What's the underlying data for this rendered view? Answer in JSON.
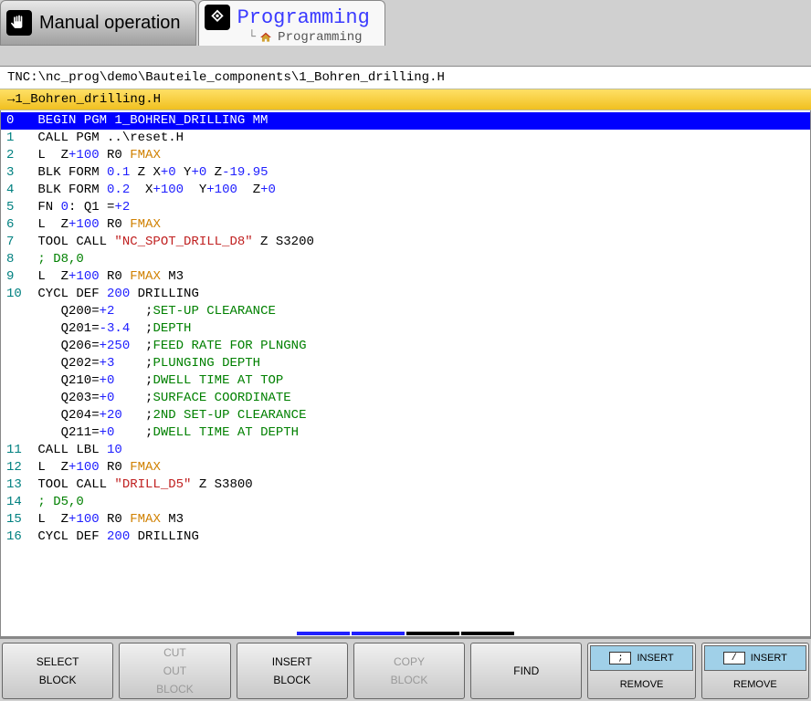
{
  "tabs": {
    "manual": "Manual operation",
    "programming": "Programming",
    "sub": "Programming"
  },
  "path": "TNC:\\nc_prog\\demo\\Bauteile_components\\1_Bohren_drilling.H",
  "file": "1_Bohren_drilling.H",
  "code": {
    "l0": {
      "n": "0",
      "a": " BEGIN PGM 1_BOHREN_DRILLING MM"
    },
    "l1": {
      "n": "1",
      "a": " CALL PGM ..\\reset.H"
    },
    "l2": {
      "n": "2",
      "a": " L  Z",
      "b": "+100",
      "c": " R0 ",
      "d": "FMAX"
    },
    "l3": {
      "n": "3",
      "a": " BLK FORM ",
      "b": "0.1",
      "c": " Z X",
      "d": "+0",
      "e": " Y",
      "f": "+0",
      "g": " Z",
      "h": "-19.95"
    },
    "l4": {
      "n": "4",
      "a": " BLK FORM ",
      "b": "0.2",
      "c": "  X",
      "d": "+100",
      "e": "  Y",
      "f": "+100",
      "g": "  Z",
      "h": "+0"
    },
    "l5": {
      "n": "5",
      "a": " FN ",
      "b": "0",
      "c": ": Q1 =",
      "d": "+2"
    },
    "l6": {
      "n": "6",
      "a": " L  Z",
      "b": "+100",
      "c": " R0 ",
      "d": "FMAX"
    },
    "l7": {
      "n": "7",
      "a": " TOOL CALL ",
      "b": "\"NC_SPOT_DRILL_D8\"",
      "c": " Z S3200"
    },
    "l8": {
      "n": "8",
      "a": " ; D8,0"
    },
    "l9": {
      "n": "9",
      "a": " L  Z",
      "b": "+100",
      "c": " R0 ",
      "d": "FMAX",
      "e": " M3"
    },
    "l10": {
      "n": "10",
      "a": " CYCL DEF ",
      "b": "200",
      "c": " DRILLING"
    },
    "q200": {
      "a": "    Q200=",
      "b": "+2",
      "c": "    ;",
      "d": "SET-UP CLEARANCE"
    },
    "q201": {
      "a": "    Q201=",
      "b": "-3.4",
      "c": "  ;",
      "d": "DEPTH"
    },
    "q206": {
      "a": "    Q206=",
      "b": "+250",
      "c": "  ;",
      "d": "FEED RATE FOR PLNGNG"
    },
    "q202": {
      "a": "    Q202=",
      "b": "+3",
      "c": "    ;",
      "d": "PLUNGING DEPTH"
    },
    "q210": {
      "a": "    Q210=",
      "b": "+0",
      "c": "    ;",
      "d": "DWELL TIME AT TOP"
    },
    "q203": {
      "a": "    Q203=",
      "b": "+0",
      "c": "    ;",
      "d": "SURFACE COORDINATE"
    },
    "q204": {
      "a": "    Q204=",
      "b": "+20",
      "c": "   ;",
      "d": "2ND SET-UP CLEARANCE"
    },
    "q211": {
      "a": "    Q211=",
      "b": "+0",
      "c": "    ;",
      "d": "DWELL TIME AT DEPTH"
    },
    "l11": {
      "n": "11",
      "a": " CALL LBL ",
      "b": "10"
    },
    "l12": {
      "n": "12",
      "a": " L  Z",
      "b": "+100",
      "c": " R0 ",
      "d": "FMAX"
    },
    "l13": {
      "n": "13",
      "a": " TOOL CALL ",
      "b": "\"DRILL_D5\"",
      "c": " Z S3800"
    },
    "l14": {
      "n": "14",
      "a": " ; D5,0"
    },
    "l15": {
      "n": "15",
      "a": " L  Z",
      "b": "+100",
      "c": " R0 ",
      "d": "FMAX",
      "e": " M3"
    },
    "l16": {
      "n": "16",
      "a": " CYCL DEF ",
      "b": "200",
      "c": " DRILLING"
    }
  },
  "sk": {
    "select1": "SELECT",
    "select2": "BLOCK",
    "cut1": "CUT",
    "cut2": "OUT",
    "cut3": "BLOCK",
    "insert1": "INSERT",
    "insert2": "BLOCK",
    "copy1": "COPY",
    "copy2": "BLOCK",
    "find": "FIND",
    "ins": "INSERT",
    "rem": "REMOVE",
    "semi": ";",
    "slash": "/"
  }
}
